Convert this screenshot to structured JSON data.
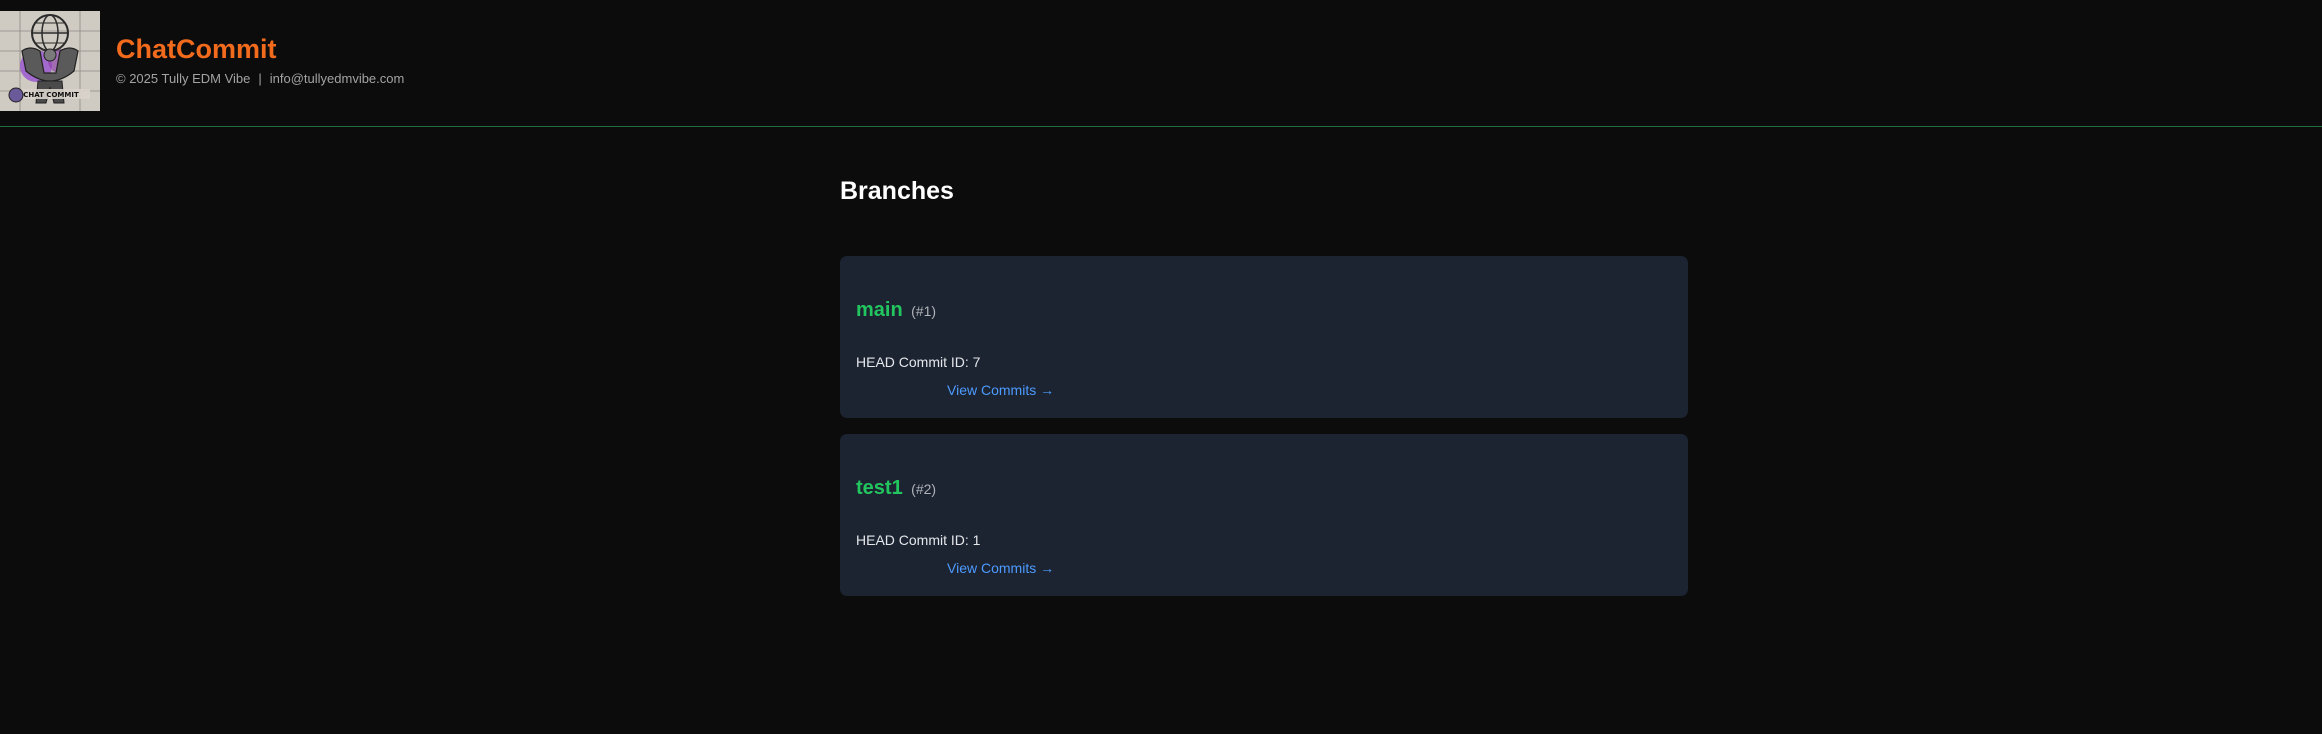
{
  "header": {
    "brand": "ChatCommit",
    "logo_text": "CHAT COMMIT",
    "copyright": "© 2025 Tully EDM Vibe",
    "separator": "|",
    "email": "info@tullyedmvibe.com"
  },
  "page": {
    "title": "Branches"
  },
  "branches": [
    {
      "name": "main",
      "number": "(#1)",
      "head_commit": "HEAD Commit ID: 7",
      "link_label": "View Commits →"
    },
    {
      "name": "test1",
      "number": "(#2)",
      "head_commit": "HEAD Commit ID: 1",
      "link_label": "View Commits →"
    }
  ],
  "colors": {
    "background": "#0c0c0c",
    "brand": "#f26b1d",
    "branch_name": "#22c55e",
    "link": "#4d9bff",
    "card": "#1c2331",
    "header_border": "#1f6f3f"
  }
}
